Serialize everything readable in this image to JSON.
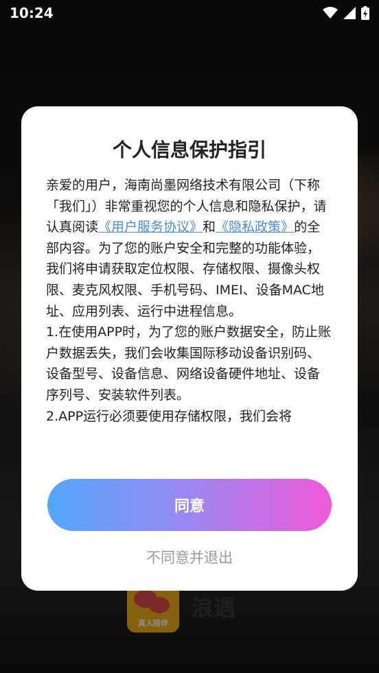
{
  "status_bar": {
    "time": "10:24",
    "icons": [
      "wifi-icon",
      "cellular-signal-icon",
      "battery-charging-icon"
    ]
  },
  "background": {
    "app_name": "浪遇",
    "logo_tag": "真人陪伴"
  },
  "dialog": {
    "title": "个人信息保护指引",
    "paragraph1": {
      "text_before": "亲爱的用户，海南尚墨网络技术有限公司（下称「我们」）非常重视您的个人信息和隐私保护，请认真阅读",
      "link1": "《用户服务协议》",
      "text_middle": "和",
      "link2": "《隐私政策》",
      "text_after": "的全部内容。为了您的账户安全和完整的功能体验，我们将申请获取定位权限、存储权限、摄像头权限、麦克风权限、手机号码、IMEI、设备MAC地址、应用列表、运行中进程信息。"
    },
    "paragraph2": "1.在使用APP时，为了您的账户数据安全，防止账户数据丢失，我们会收集国际移动设备识别码、设备型号、设备信息、网络设备硬件地址、设备序列号、安装软件列表。",
    "paragraph3": "2.APP运行必须要使用存储权限，我们会将",
    "agree_label": "同意",
    "disagree_label": "不同意并退出"
  },
  "colors": {
    "link": "#4a8fd8",
    "button_gradient_start": "#53a7ff",
    "button_gradient_end": "#f059d8",
    "disagree_text": "#9a9a9a"
  }
}
